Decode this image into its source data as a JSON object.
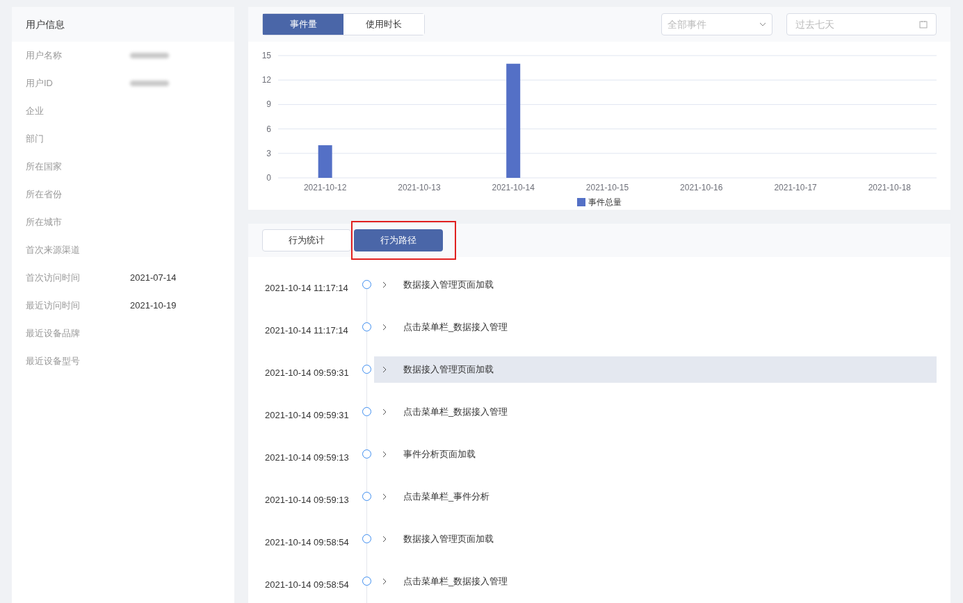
{
  "user_info": {
    "title": "用户信息",
    "fields": [
      {
        "label": "用户名称",
        "blurred": true
      },
      {
        "label": "用户ID",
        "blurred": true
      },
      {
        "label": "企业",
        "blurred": false
      },
      {
        "label": "部门",
        "blurred": false
      },
      {
        "label": "所在国家",
        "blurred": false
      },
      {
        "label": "所在省份",
        "blurred": false
      },
      {
        "label": "所在城市",
        "blurred": false
      },
      {
        "label": "首次来源渠道",
        "blurred": false
      },
      {
        "label": "首次访问时间",
        "value": "2021-07-14",
        "blurred": false
      },
      {
        "label": "最近访问时间",
        "value": "2021-10-19",
        "blurred": false
      },
      {
        "label": "最近设备品牌",
        "blurred": false
      },
      {
        "label": "最近设备型号",
        "blurred": false
      }
    ]
  },
  "chart_panel": {
    "tabs": [
      {
        "label": "事件量",
        "selected": true
      },
      {
        "label": "使用时长",
        "selected": false
      }
    ],
    "event_select": {
      "placeholder": "全部事件"
    },
    "date_field": {
      "placeholder": "过去七天"
    },
    "chart_data": {
      "type": "bar",
      "grid": true,
      "categories": [
        "2021-10-12",
        "2021-10-13",
        "2021-10-14",
        "2021-10-15",
        "2021-10-16",
        "2021-10-17",
        "2021-10-18"
      ],
      "ylim": [
        0,
        15
      ],
      "yticks": [
        0,
        3,
        6,
        9,
        12,
        15
      ],
      "series": [
        {
          "name": "事件总量",
          "color": "#5470c6",
          "values": [
            4,
            0,
            14,
            0,
            0,
            0,
            0
          ]
        }
      ]
    }
  },
  "behavior_panel": {
    "tabs": [
      {
        "label": "行为统计",
        "selected": false,
        "highlighted": false
      },
      {
        "label": "行为路径",
        "selected": true,
        "highlighted": true
      }
    ],
    "events": [
      {
        "time": "2021-10-14 11:17:14",
        "name": "数据接入管理页面加载",
        "hovered": false
      },
      {
        "time": "2021-10-14 11:17:14",
        "name": "点击菜单栏_数据接入管理",
        "hovered": false
      },
      {
        "time": "2021-10-14 09:59:31",
        "name": "数据接入管理页面加载",
        "hovered": true
      },
      {
        "time": "2021-10-14 09:59:31",
        "name": "点击菜单栏_数据接入管理",
        "hovered": false
      },
      {
        "time": "2021-10-14 09:59:13",
        "name": "事件分析页面加载",
        "hovered": false
      },
      {
        "time": "2021-10-14 09:59:13",
        "name": "点击菜单栏_事件分析",
        "hovered": false
      },
      {
        "time": "2021-10-14 09:58:54",
        "name": "数据接入管理页面加载",
        "hovered": false
      },
      {
        "time": "2021-10-14 09:58:54",
        "name": "点击菜单栏_数据接入管理",
        "hovered": false
      }
    ]
  }
}
